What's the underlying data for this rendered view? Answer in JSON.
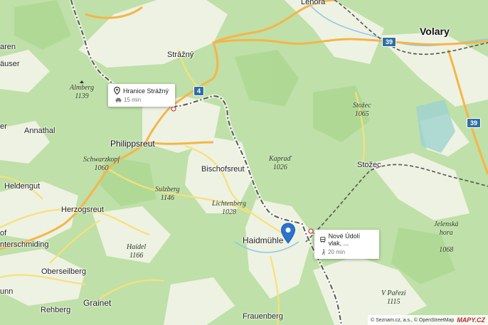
{
  "towns": {
    "lenora": "Lenora",
    "volary": "Volary",
    "strazny": "Strážný",
    "hauser": "äuser",
    "aren": "aren",
    "annathal": "Annathal",
    "philippsreut": "Philippsreut",
    "bischofsreut": "Bischofsreut",
    "stozec": "Stožec",
    "heldengut": "Heldengut",
    "herzogsreut": "Herzogsreut",
    "of": "of",
    "nterschmiding": "nterschmiding",
    "haidmuhle": "Haidmühle",
    "oberseilberg": "Oberseilberg",
    "unn": "unn",
    "rehberg": "Rehberg",
    "grainet": "Grainet",
    "frauenberg": "Frauenberg",
    "er": "er"
  },
  "peaks": {
    "almberg": {
      "name": "Almberg",
      "elev": "1139"
    },
    "schwarzkopf": {
      "name": "Schwarzkopf",
      "elev": "1060"
    },
    "sulzberg": {
      "name": "Sulzberg",
      "elev": "1146"
    },
    "lichtenberg": {
      "name": "Lichtenberg",
      "elev": "1028"
    },
    "haidel": {
      "name": "Haidel",
      "elev": "1166"
    },
    "kaprad": {
      "name": "Kapraď",
      "elev": "1026"
    },
    "stozec_peak": {
      "name": "Stožec",
      "elev": "1065"
    },
    "jelenska": {
      "name": "Jelenská\nhora",
      "elev": "1068"
    },
    "v_parezi": {
      "name": "V Pařezi",
      "elev": "1115"
    }
  },
  "road_shields": {
    "r4": "4",
    "r39a": "39",
    "r39b": "39"
  },
  "callouts": {
    "hranice": {
      "title": "Hranice Strážný",
      "sub": "15 min",
      "icon": "location-pin-icon",
      "sub_icon": "car-icon"
    },
    "nove_udoli": {
      "title": "Nové Údolí vlak, ...",
      "sub": "20 min",
      "icon": "bus-icon",
      "sub_icon": "walking-icon"
    }
  },
  "attribution": {
    "text": "© Seznam.cz, a.s., © OpenStreetMap",
    "logo": "MAPY.CZ"
  },
  "colors": {
    "forest": "#bfe0a8",
    "meadow": "#eef3e3",
    "road_major": "#f5b548",
    "road_minor": "#f7e07a",
    "border": "#5a5a5a",
    "marker": "#2a74d0",
    "water": "#8fc6e8"
  }
}
